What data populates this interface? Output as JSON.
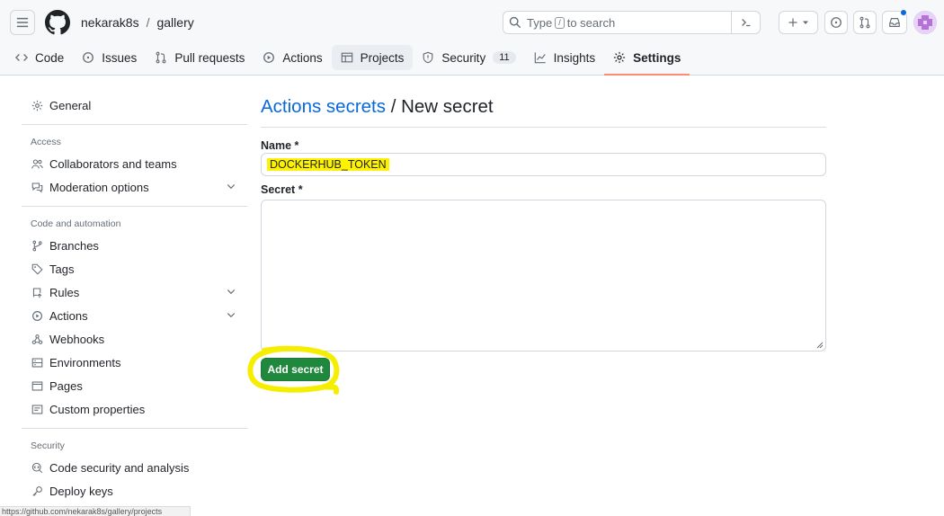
{
  "header": {
    "owner": "nekarak8s",
    "separator": "/",
    "repo": "gallery",
    "search_prefix": "Type",
    "search_key": "/",
    "search_suffix": "to search",
    "notification_dot_color": "#0969da"
  },
  "tabs": [
    {
      "label": "Code",
      "icon": "code-icon"
    },
    {
      "label": "Issues",
      "icon": "issue-icon"
    },
    {
      "label": "Pull requests",
      "icon": "pull-request-icon"
    },
    {
      "label": "Actions",
      "icon": "play-icon"
    },
    {
      "label": "Projects",
      "icon": "table-icon"
    },
    {
      "label": "Security",
      "icon": "shield-icon",
      "count": "11"
    },
    {
      "label": "Insights",
      "icon": "graph-icon"
    },
    {
      "label": "Settings",
      "icon": "gear-icon",
      "active": true
    }
  ],
  "sidebar": {
    "general": "General",
    "access_heading": "Access",
    "access": [
      "Collaborators and teams",
      "Moderation options"
    ],
    "code_heading": "Code and automation",
    "code": [
      "Branches",
      "Tags",
      "Rules",
      "Actions",
      "Webhooks",
      "Environments",
      "Pages",
      "Custom properties"
    ],
    "security_heading": "Security",
    "security": [
      "Code security and analysis",
      "Deploy keys"
    ]
  },
  "main": {
    "title_link": "Actions secrets",
    "title_rest": " / New secret",
    "name_label": "Name *",
    "name_value": "DOCKERHUB_TOKEN",
    "secret_label": "Secret *",
    "secret_value": "",
    "button": "Add secret"
  },
  "status_url": "https://github.com/nekarak8s/gallery/projects",
  "colors": {
    "accent_link": "#0969da",
    "primary_button": "#1f883d",
    "highlight": "#fff200",
    "active_tab_underline": "#fd8c73"
  }
}
